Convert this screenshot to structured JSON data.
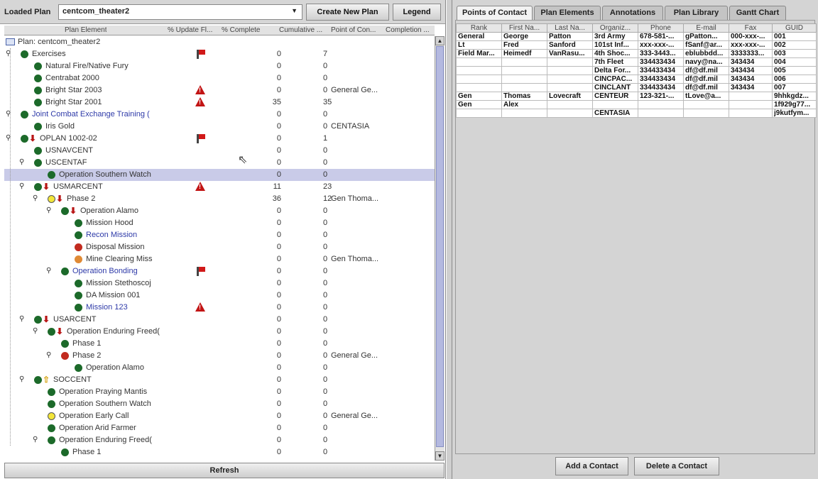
{
  "toolbar": {
    "loaded_plan_label": "Loaded Plan",
    "plan_value": "centcom_theater2",
    "create_label": "Create New Plan",
    "legend_label": "Legend"
  },
  "tree": {
    "columns": [
      "Plan Element",
      "% Update Fl...",
      "% Complete",
      "Cumulative ...",
      "Point of Con...",
      "Completion ..."
    ],
    "root": "Plan: centcom_theater2",
    "rows": [
      {
        "name": "Exercises",
        "pc": "0",
        "cum": "7",
        "poc": "",
        "status": "green",
        "flag": "flag"
      },
      {
        "name": "Natural Fire/Native Fury",
        "pc": "0",
        "cum": "0",
        "poc": "",
        "status": "green",
        "flag": ""
      },
      {
        "name": "Centrabat 2000",
        "pc": "0",
        "cum": "0",
        "poc": "",
        "status": "green",
        "flag": ""
      },
      {
        "name": "Bright Star 2003",
        "pc": "0",
        "cum": "0",
        "poc": "General Ge...",
        "status": "green",
        "flag": "warn"
      },
      {
        "name": "Bright Star 2001",
        "pc": "35",
        "cum": "35",
        "poc": "",
        "status": "green",
        "flag": "warn"
      },
      {
        "name": "Joint Combat Exchange Training (",
        "pc": "0",
        "cum": "0",
        "poc": "",
        "status": "green",
        "flag": ""
      },
      {
        "name": "Iris Gold",
        "pc": "0",
        "cum": "0",
        "poc": "CENTASIA",
        "status": "green",
        "flag": ""
      },
      {
        "name": "OPLAN 1002-02",
        "pc": "0",
        "cum": "1",
        "poc": "",
        "status": "green",
        "flag": "flag"
      },
      {
        "name": "USNAVCENT",
        "pc": "0",
        "cum": "0",
        "poc": "",
        "status": "green",
        "flag": ""
      },
      {
        "name": "USCENTAF",
        "pc": "0",
        "cum": "0",
        "poc": "",
        "status": "green",
        "flag": ""
      },
      {
        "name": "Operation Southern Watch",
        "pc": "0",
        "cum": "0",
        "poc": "",
        "status": "green",
        "flag": ""
      },
      {
        "name": "USMARCENT",
        "pc": "11",
        "cum": "23",
        "poc": "",
        "status": "green",
        "flag": "warn"
      },
      {
        "name": "Phase 2",
        "pc": "36",
        "cum": "12",
        "poc": "Gen Thoma...",
        "status": "yellow",
        "flag": ""
      },
      {
        "name": "Operation Alamo",
        "pc": "0",
        "cum": "0",
        "poc": "",
        "status": "green",
        "flag": ""
      },
      {
        "name": "Mission Hood",
        "pc": "0",
        "cum": "0",
        "poc": "",
        "status": "green",
        "flag": ""
      },
      {
        "name": "Recon Mission",
        "pc": "0",
        "cum": "0",
        "poc": "",
        "status": "green",
        "flag": ""
      },
      {
        "name": "Disposal Mission",
        "pc": "0",
        "cum": "0",
        "poc": "",
        "status": "red",
        "flag": ""
      },
      {
        "name": "Mine Clearing Miss",
        "pc": "0",
        "cum": "0",
        "poc": "Gen Thoma...",
        "status": "orange",
        "flag": ""
      },
      {
        "name": "Operation Bonding",
        "pc": "0",
        "cum": "0",
        "poc": "",
        "status": "green",
        "flag": "flag"
      },
      {
        "name": "Mission Stethoscoj",
        "pc": "0",
        "cum": "0",
        "poc": "",
        "status": "green",
        "flag": ""
      },
      {
        "name": "DA Mission 001",
        "pc": "0",
        "cum": "0",
        "poc": "",
        "status": "green",
        "flag": ""
      },
      {
        "name": "Mission 123",
        "pc": "0",
        "cum": "0",
        "poc": "",
        "status": "green",
        "flag": "warn"
      },
      {
        "name": "USARCENT",
        "pc": "0",
        "cum": "0",
        "poc": "",
        "status": "green",
        "flag": ""
      },
      {
        "name": "Operation Enduring Freed(",
        "pc": "0",
        "cum": "0",
        "poc": "",
        "status": "green",
        "flag": ""
      },
      {
        "name": "Phase 1",
        "pc": "0",
        "cum": "0",
        "poc": "",
        "status": "green",
        "flag": ""
      },
      {
        "name": "Phase 2",
        "pc": "0",
        "cum": "0",
        "poc": "General Ge...",
        "status": "red",
        "flag": ""
      },
      {
        "name": "Operation Alamo",
        "pc": "0",
        "cum": "0",
        "poc": "",
        "status": "green",
        "flag": ""
      },
      {
        "name": "SOCCENT",
        "pc": "0",
        "cum": "0",
        "poc": "",
        "status": "green",
        "flag": ""
      },
      {
        "name": "Operation Praying Mantis",
        "pc": "0",
        "cum": "0",
        "poc": "",
        "status": "green",
        "flag": ""
      },
      {
        "name": "Operation Southern Watch",
        "pc": "0",
        "cum": "0",
        "poc": "",
        "status": "green",
        "flag": ""
      },
      {
        "name": "Operation Early Call",
        "pc": "0",
        "cum": "0",
        "poc": "General Ge...",
        "status": "yellow",
        "flag": ""
      },
      {
        "name": "Operation Arid Farmer",
        "pc": "0",
        "cum": "0",
        "poc": "",
        "status": "green",
        "flag": ""
      },
      {
        "name": "Operation Enduring Freed(",
        "pc": "0",
        "cum": "0",
        "poc": "",
        "status": "green",
        "flag": ""
      },
      {
        "name": "Phase 1",
        "pc": "0",
        "cum": "0",
        "poc": "",
        "status": "green",
        "flag": ""
      }
    ]
  },
  "refresh_label": "Refresh",
  "tabs": [
    "Points of Contact",
    "Plan Elements",
    "Annotations",
    "Plan Library",
    "Gantt Chart"
  ],
  "contacts": {
    "headers": [
      "Rank",
      "First Na...",
      "Last Na...",
      "Organiz...",
      "Phone",
      "E-mail",
      "Fax",
      "GUID"
    ],
    "rows": [
      [
        "General",
        "George",
        "Patton",
        "3rd Army",
        "678-581-...",
        "gPatton...",
        "000-xxx-...",
        "001"
      ],
      [
        "Lt",
        "Fred",
        "Sanford",
        "101st Inf...",
        "xxx-xxx-...",
        "fSanf@ar...",
        "xxx-xxx-...",
        "002"
      ],
      [
        "Field Mar...",
        "Heimedf",
        "VanRasu...",
        "4th Shoc...",
        "333-3443...",
        "eblubbdd...",
        "3333333...",
        "003"
      ],
      [
        "",
        "",
        "",
        "7th Fleet",
        "334433434",
        "navy@na...",
        "343434",
        "004"
      ],
      [
        "",
        "",
        "",
        "Delta For...",
        "334433434",
        "df@df.mil",
        "343434",
        "005"
      ],
      [
        "",
        "",
        "",
        "CINCPAC...",
        "334433434",
        "df@df.mil",
        "343434",
        "006"
      ],
      [
        "",
        "",
        "",
        "CINCLANT",
        "334433434",
        "df@df.mil",
        "343434",
        "007"
      ],
      [
        "Gen",
        "Thomas",
        "Lovecraft",
        "CENTEUR",
        "123-321-...",
        "tLove@a...",
        "",
        "9hhkgdz..."
      ],
      [
        "Gen",
        "Alex",
        "",
        "",
        "",
        "",
        "",
        "1f929g77..."
      ],
      [
        "",
        "",
        "",
        "CENTASIA",
        "",
        "",
        "",
        "j9kutfym..."
      ]
    ]
  },
  "add_contact_label": "Add a Contact",
  "delete_contact_label": "Delete a Contact",
  "colors": {
    "selected_row": "#c9cbe8",
    "green": "#1c6a2a",
    "red": "#c22b1f",
    "yellow": "#f3e63a",
    "orange": "#e08a35",
    "link_blue": "#2e3aa8"
  }
}
